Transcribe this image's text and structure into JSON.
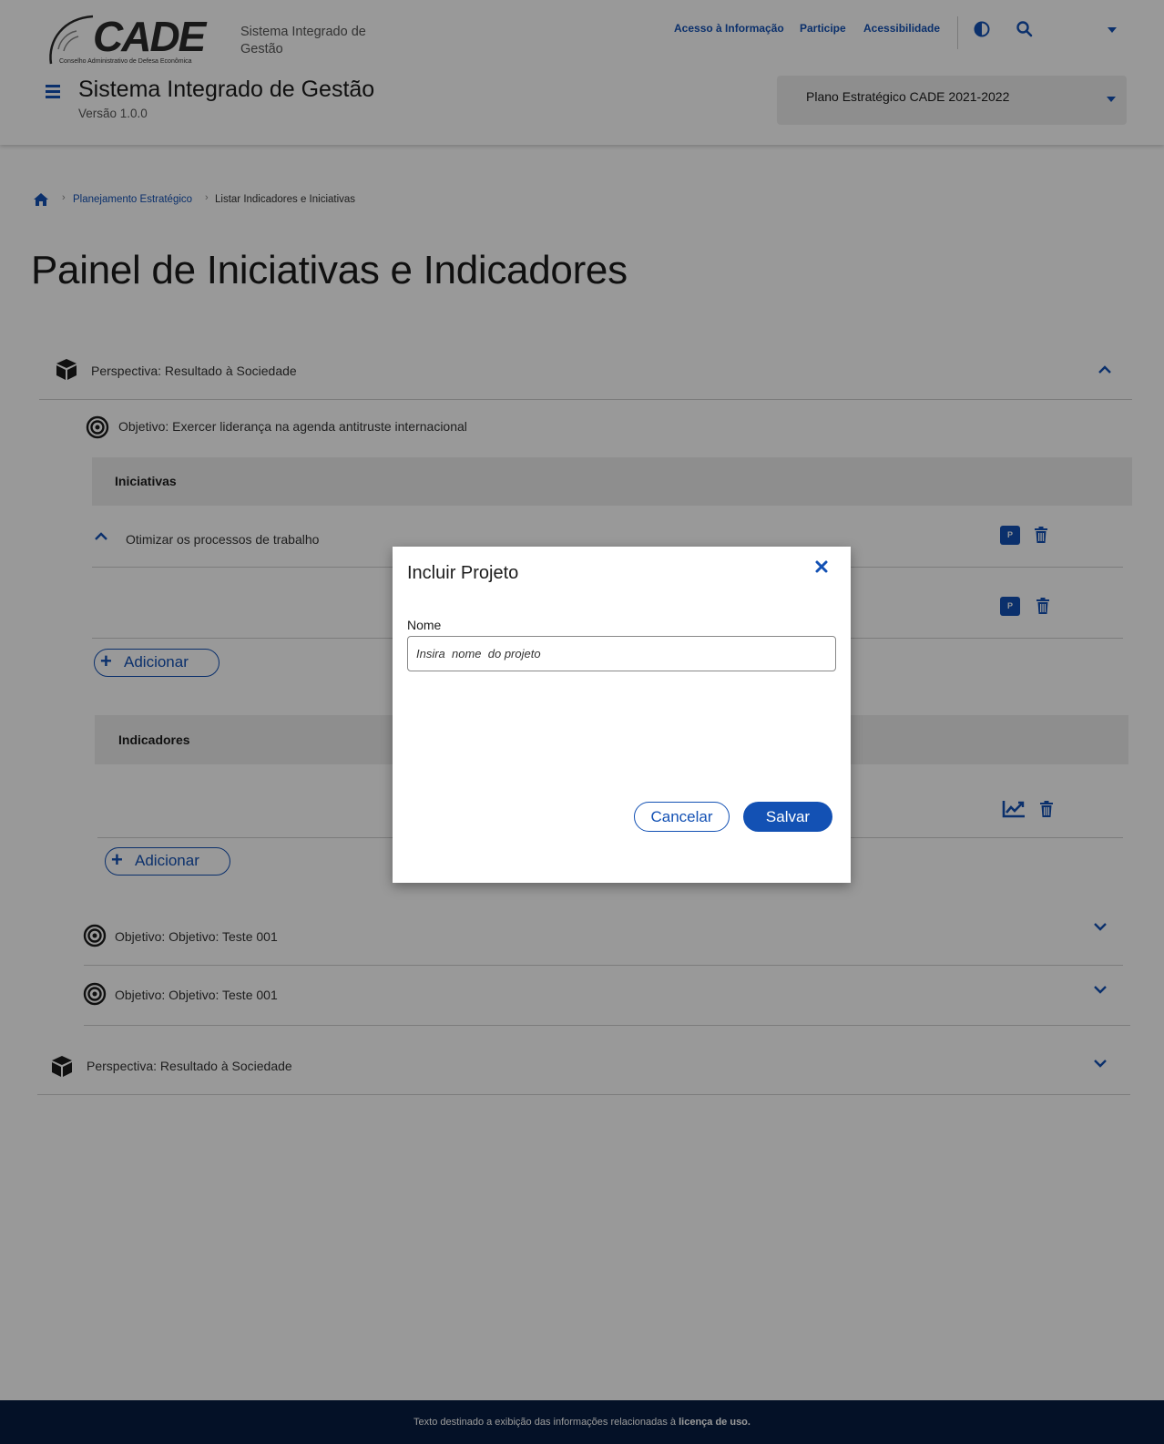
{
  "header": {
    "logo_text": "CADE",
    "logo_subtitle": "Conselho Administrativo de Defesa Econômica",
    "system_name_top": "Sistema Integrado de Gestão",
    "links": [
      "Acesso à Informação",
      "Participe",
      "Acessibilidade"
    ],
    "system_title": "Sistema Integrado de Gestão",
    "version": "Versão 1.0.0",
    "plan_select": "Plano Estratégico CADE 2021-2022"
  },
  "breadcrumb": {
    "items": [
      "Planejamento Estratégico",
      "Listar Indicadores e Iniciativas"
    ]
  },
  "page_title": "Painel de Iniciativas e Indicadores",
  "perspectives": [
    {
      "label": "Perspectiva: Resultado à Sociedade",
      "objectives": [
        {
          "label": "Objetivo: Exercer liderança na agenda antitruste internacional",
          "initiatives_header": "Iniciativas",
          "initiatives": [
            "Otimizar os processos de trabalho"
          ],
          "add_label": "Adicionar",
          "indicators_header": "Indicadores",
          "indicator_add_label": "Adicionar"
        },
        {
          "label": "Objetivo: Objetivo:  Teste 001"
        },
        {
          "label": "Objetivo: Objetivo:  Teste 001"
        }
      ]
    },
    {
      "label": "Perspectiva: Resultado à Sociedade"
    }
  ],
  "modal": {
    "title": "Incluir Projeto",
    "field_label": "Nome",
    "field_placeholder": "Insira  nome  do projeto",
    "cancel": "Cancelar",
    "save": "Salvar"
  },
  "footer": {
    "text": "Texto destinado a exibição das informações relacionadas à",
    "link": "licença de uso."
  },
  "badge_letter": "P",
  "colors": {
    "primary": "#1351b4",
    "footer_bg": "#071d41",
    "band": "#ededed"
  }
}
